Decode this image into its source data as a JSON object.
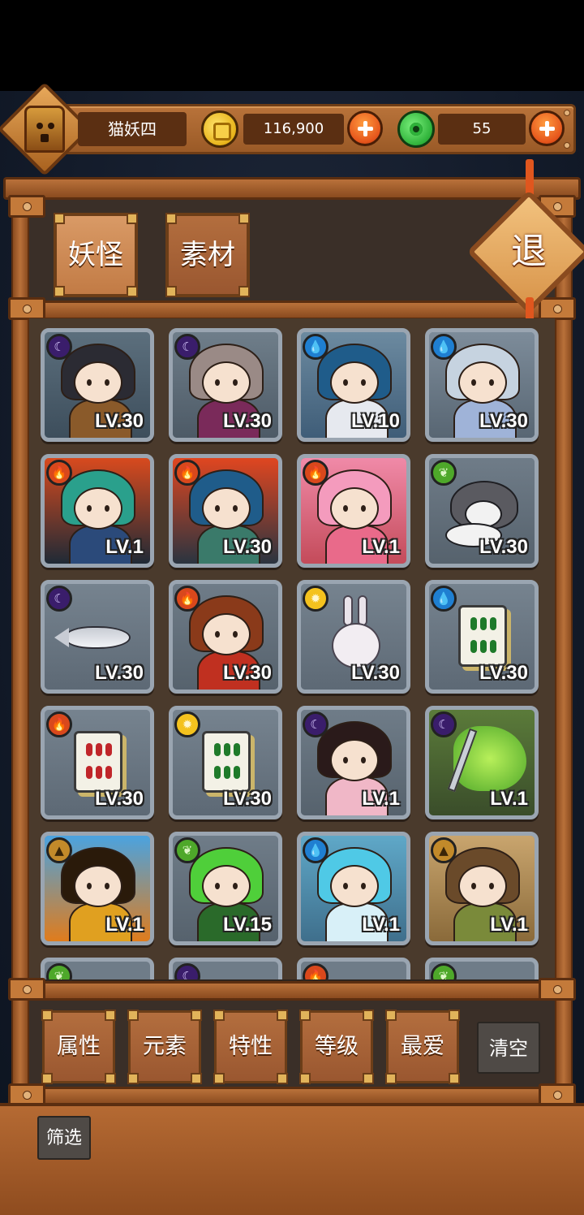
{
  "player": {
    "name": "猫妖四"
  },
  "resources": {
    "gold": "116,900",
    "jade": "55"
  },
  "tabs": [
    {
      "label": "妖怪",
      "active": true
    },
    {
      "label": "素材",
      "active": false
    }
  ],
  "exit_label": "退",
  "monsters": [
    {
      "level": "LV.30",
      "element": "dark"
    },
    {
      "level": "LV.30",
      "element": "dark"
    },
    {
      "level": "LV.10",
      "element": "water"
    },
    {
      "level": "LV.30",
      "element": "water"
    },
    {
      "level": "LV.1",
      "element": "fire"
    },
    {
      "level": "LV.30",
      "element": "fire"
    },
    {
      "level": "LV.1",
      "element": "fire"
    },
    {
      "level": "LV.30",
      "element": "wood"
    },
    {
      "level": "LV.30",
      "element": "dark"
    },
    {
      "level": "LV.30",
      "element": "fire"
    },
    {
      "level": "LV.30",
      "element": "light"
    },
    {
      "level": "LV.30",
      "element": "water"
    },
    {
      "level": "LV.30",
      "element": "fire"
    },
    {
      "level": "LV.30",
      "element": "light"
    },
    {
      "level": "LV.1",
      "element": "dark"
    },
    {
      "level": "LV.1",
      "element": "dark"
    },
    {
      "level": "LV.1",
      "element": "earth"
    },
    {
      "level": "LV.15",
      "element": "wood"
    },
    {
      "level": "LV.1",
      "element": "water"
    },
    {
      "level": "LV.1",
      "element": "earth"
    }
  ],
  "filters": [
    "属性",
    "元素",
    "特性",
    "等级",
    "最爱"
  ],
  "clear_label": "清空",
  "screen_label": "筛选",
  "colors": {
    "wood": "#9a5730",
    "card_frame": "#9aa5b1",
    "plus_orange": "#e5541b",
    "gem_green": "#2fb23a",
    "coin_gold": "#e7b31a"
  }
}
